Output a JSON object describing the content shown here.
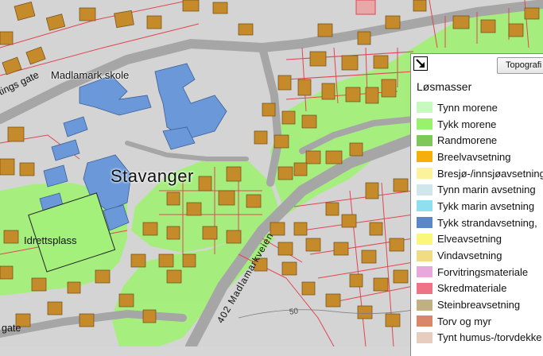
{
  "map": {
    "labels": {
      "place": "Stavanger",
      "school": "Madlamark skole",
      "sports_field": "Idrettsplass",
      "street_top": "tings gate",
      "street_bottom": "gate",
      "road": "402 Madlamarkveien",
      "contour": "50"
    },
    "colors": {
      "background": "#d6d6d6",
      "buildings": "#c58a2a",
      "public_buildings": "#6a98d8",
      "property_lines": "#e0454f",
      "roads": "#a8a8a8",
      "green": "#9ff276"
    }
  },
  "legend": {
    "tab_label": "Topografi",
    "title": "Løsmasser",
    "toggle_icon": "collapse-arrow-icon",
    "items": [
      {
        "label": "Tynn morene",
        "color": "#c8f9c1"
      },
      {
        "label": "Tykk morene",
        "color": "#98f26e"
      },
      {
        "label": "Randmorene",
        "color": "#7ec85a"
      },
      {
        "label": "Breelvavsetning",
        "color": "#f6ae0c"
      },
      {
        "label": "Bresjø-/innsjøavsetning",
        "color": "#fdf29c"
      },
      {
        "label": "Tynn marin avsetning",
        "color": "#cfe6ea"
      },
      {
        "label": "Tykk marin avsetning",
        "color": "#8fe0ef"
      },
      {
        "label": "Tykk strandavsetning,",
        "color": "#5b86c8"
      },
      {
        "label": "Elveavsetning",
        "color": "#fbf77a"
      },
      {
        "label": "Vindavsetning",
        "color": "#f0dc82"
      },
      {
        "label": "Forvitringsmateriale",
        "color": "#e9a8dc"
      },
      {
        "label": "Skredmateriale",
        "color": "#ef7386"
      },
      {
        "label": "Steinbreavsetning",
        "color": "#bfb182"
      },
      {
        "label": "Torv og myr",
        "color": "#d9866a"
      },
      {
        "label": "Tynt humus-/torvdekke",
        "color": "#e6cdbd"
      }
    ]
  }
}
